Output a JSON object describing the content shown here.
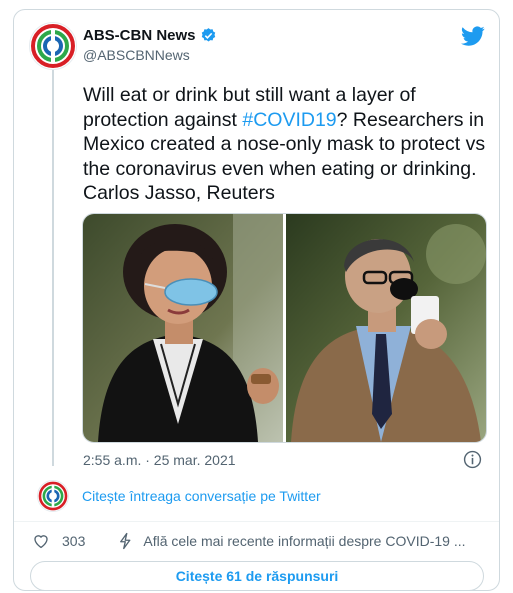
{
  "author": {
    "display_name": "ABS-CBN News",
    "handle": "@ABSCBNNews",
    "verified_icon": "verified-badge-icon",
    "avatar_icon": "abs-cbn-logo-icon"
  },
  "tweet": {
    "text_before_hashtag": "Will eat or drink but still want a layer of protection against ",
    "hashtag": "#COVID19",
    "text_after_hashtag": "? Researchers in Mexico created a nose-only mask to protect vs the coronavirus even when eating or drinking. Carlos Jasso, Reuters",
    "timestamp": "2:55 a.m. · 25 mar. 2021",
    "media": [
      {
        "icon": "photo-woman-nose-mask"
      },
      {
        "icon": "photo-man-nose-mask-drinking"
      }
    ]
  },
  "thread": {
    "read_conversation_label": "Citește întreaga conversație pe Twitter"
  },
  "actions": {
    "like_count": "303",
    "covid_info_label": "Află cele mai recente informații despre COVID-19 ..."
  },
  "replies_button_label": "Citește 61 de răspunsuri",
  "colors": {
    "accent": "#1d9bf0",
    "text_primary": "#0f1419",
    "text_secondary": "#536471",
    "border": "#cfd9de"
  },
  "icons": {
    "twitter": "twitter-bird-icon",
    "info": "info-icon",
    "like": "heart-icon",
    "covid_info": "lightning-icon"
  }
}
